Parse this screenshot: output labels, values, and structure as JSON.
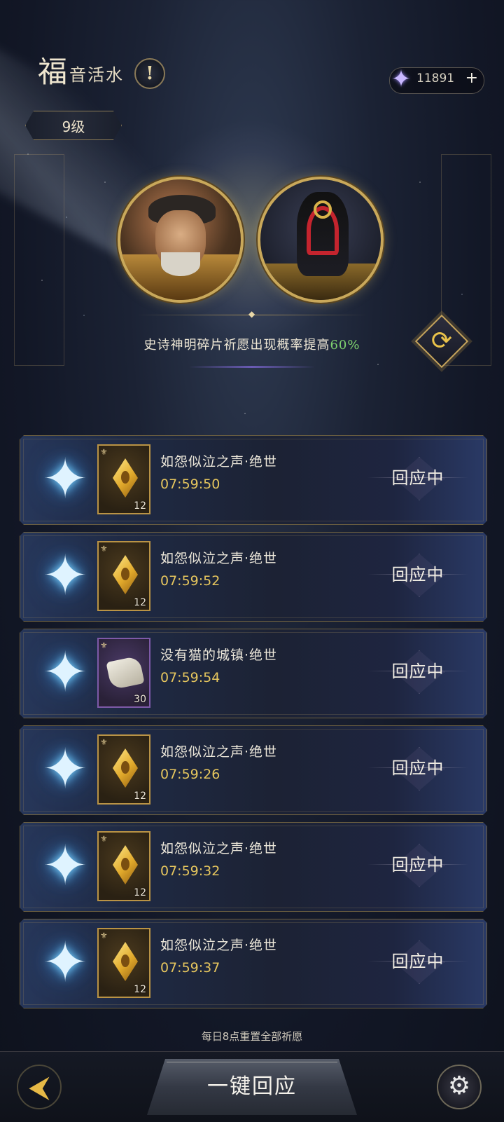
{
  "header": {
    "title_big": "福",
    "title_small": "音活水",
    "info_glyph": "!",
    "level": "9级"
  },
  "currency": {
    "icon": "crystal-star-icon",
    "value": "11891",
    "plus": "+"
  },
  "banner": {
    "bonus_prefix": "史诗神明碎片祈愿出现概率提高",
    "bonus_value": "60%",
    "bonus_color": "#7fd36f",
    "refresh_glyph": "⟳"
  },
  "wishes": [
    {
      "name": "如怨似泣之声·绝世",
      "timer": "07:59:50",
      "item": "golden-crystal",
      "qty": "12",
      "status": "回应中"
    },
    {
      "name": "如怨似泣之声·绝世",
      "timer": "07:59:52",
      "item": "golden-crystal",
      "qty": "12",
      "status": "回应中"
    },
    {
      "name": "没有猫的城镇·绝世",
      "timer": "07:59:54",
      "item": "scroll",
      "qty": "30",
      "status": "回应中"
    },
    {
      "name": "如怨似泣之声·绝世",
      "timer": "07:59:26",
      "item": "golden-crystal",
      "qty": "12",
      "status": "回应中"
    },
    {
      "name": "如怨似泣之声·绝世",
      "timer": "07:59:32",
      "item": "golden-crystal",
      "qty": "12",
      "status": "回应中"
    },
    {
      "name": "如怨似泣之声·绝世",
      "timer": "07:59:37",
      "item": "golden-crystal",
      "qty": "12",
      "status": "回应中"
    }
  ],
  "footer": {
    "reset_note": "每日8点重置全部祈愿",
    "main_button": "一键回应",
    "back_glyph": "⮜",
    "settings_glyph": "⚙"
  },
  "colors": {
    "accent_gold": "#c9a85a",
    "timer": "#e6c65e",
    "star_glow": "#7cd4ff"
  }
}
